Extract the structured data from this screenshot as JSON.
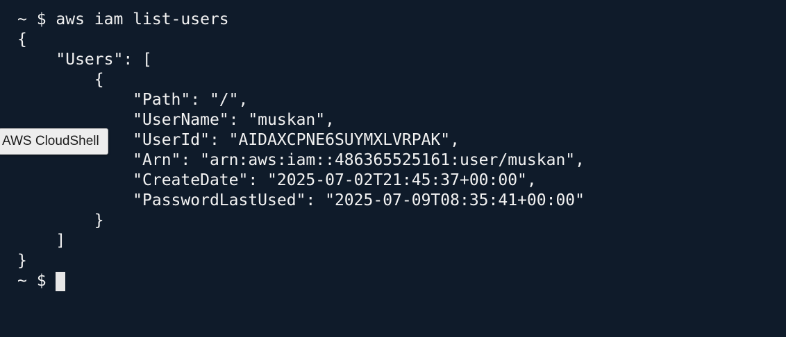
{
  "terminal": {
    "lines": [
      "~ $ aws iam list-users",
      "{",
      "    \"Users\": [",
      "        {",
      "            \"Path\": \"/\",",
      "            \"UserName\": \"muskan\",",
      "            \"UserId\": \"AIDAXCPNE6SUYMXLVRPAK\",",
      "            \"Arn\": \"arn:aws:iam::486365525161:user/muskan\",",
      "            \"CreateDate\": \"2025-07-02T21:45:37+00:00\",",
      "            \"PasswordLastUsed\": \"2025-07-09T08:35:41+00:00\"",
      "        }",
      "    ]",
      "}"
    ],
    "prompt": "~ $ "
  },
  "tooltip": {
    "text": "AWS CloudShell"
  },
  "colors": {
    "background": "#0f1b2a",
    "text": "#f2f2f2",
    "cursor": "#e7e7e7",
    "tooltip_bg": "#ededed"
  }
}
